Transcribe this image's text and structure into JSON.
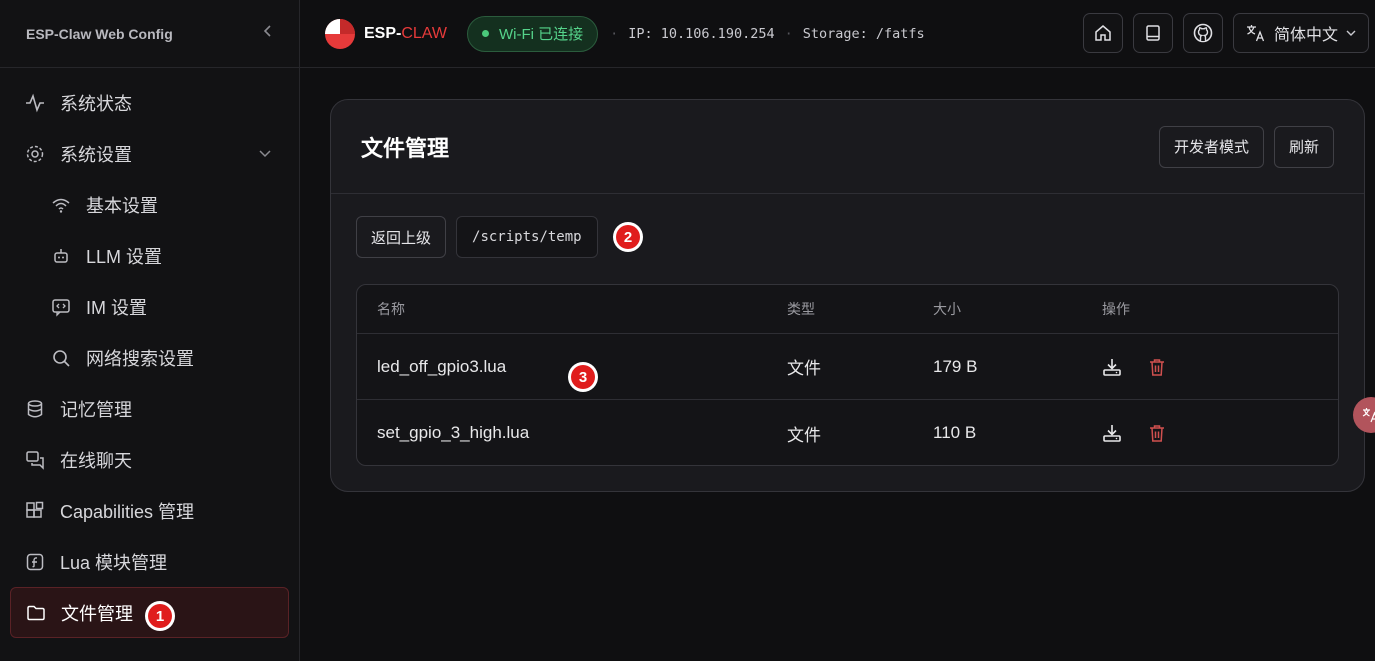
{
  "sidebar": {
    "title": "ESP-Claw Web Config",
    "items": [
      {
        "label": "系统状态"
      },
      {
        "label": "系统设置"
      },
      {
        "label": "基本设置"
      },
      {
        "label": "LLM 设置"
      },
      {
        "label": "IM 设置"
      },
      {
        "label": "网络搜索设置"
      },
      {
        "label": "记忆管理"
      },
      {
        "label": "在线聊天"
      },
      {
        "label": "Capabilities 管理"
      },
      {
        "label": "Lua 模块管理"
      },
      {
        "label": "文件管理"
      }
    ]
  },
  "topbar": {
    "logo_prefix": "ESP-",
    "logo_suffix": "CLAW",
    "wifi_status": "Wi-Fi 已连接",
    "ip": "IP: 10.106.190.254",
    "storage": "Storage: /fatfs",
    "language": "简体中文"
  },
  "main": {
    "title": "文件管理",
    "developer_mode": "开发者模式",
    "refresh": "刷新",
    "back": "返回上级",
    "path": "/scripts/temp",
    "columns": {
      "name": "名称",
      "type": "类型",
      "size": "大小",
      "ops": "操作"
    },
    "rows": [
      {
        "name": "led_off_gpio3.lua",
        "type": "文件",
        "size": "179 B"
      },
      {
        "name": "set_gpio_3_high.lua",
        "type": "文件",
        "size": "110 B"
      }
    ]
  },
  "annotations": [
    "1",
    "2",
    "3"
  ],
  "colors": {
    "accent": "#e63a3a",
    "success": "#55d38a",
    "background": "#0f0f11"
  }
}
